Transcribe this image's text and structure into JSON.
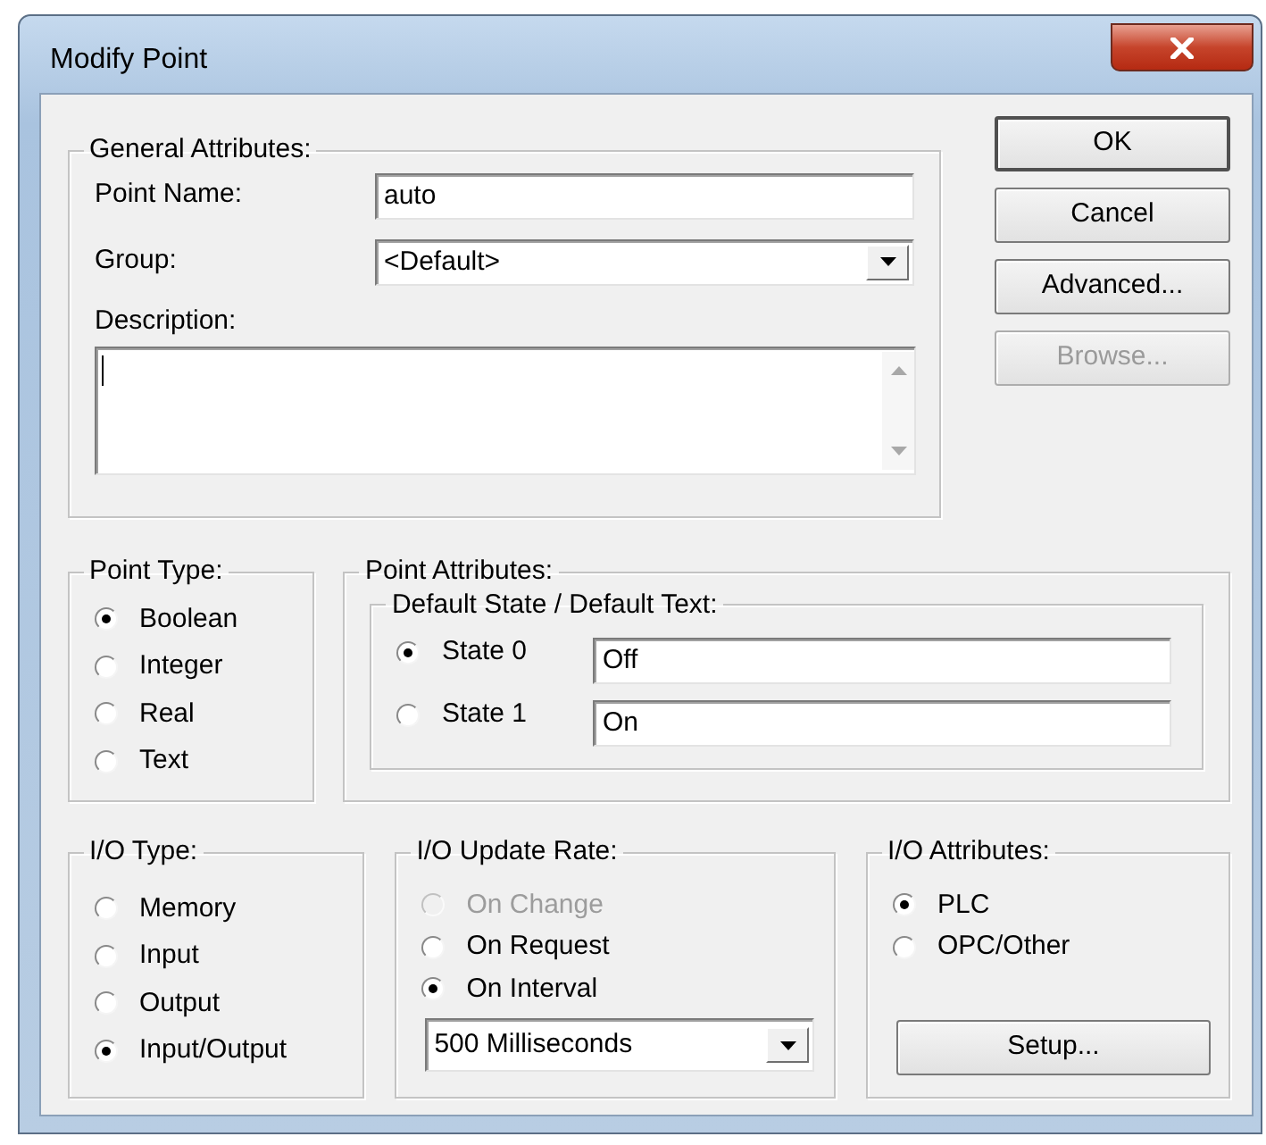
{
  "window": {
    "title": "Modify Point"
  },
  "general": {
    "title": "General Attributes:",
    "fields": [
      {
        "label": "Point Name:",
        "kind": "text",
        "value": "auto"
      },
      {
        "label": "Group:",
        "kind": "dropdown",
        "value": "<Default>"
      }
    ],
    "description": {
      "label": "Description:"
    }
  },
  "buttons": [
    {
      "label": "OK",
      "disabled": false
    },
    {
      "label": "Cancel",
      "disabled": false
    },
    {
      "label": "Advanced...",
      "disabled": false
    },
    {
      "label": "Browse...",
      "disabled": true
    }
  ],
  "point_type": {
    "title": "Point Type:",
    "options": [
      {
        "label": "Boolean",
        "selected": true
      },
      {
        "label": "Integer",
        "selected": false
      },
      {
        "label": "Real",
        "selected": false
      },
      {
        "label": "Text",
        "selected": false
      }
    ]
  },
  "point_attributes": {
    "title": "Point Attributes:",
    "subtitle": "Default State / Default Text:",
    "states": [
      {
        "label": "State 0",
        "selected": true,
        "value": "Off"
      },
      {
        "label": "State 1",
        "selected": false,
        "value": "On"
      }
    ]
  },
  "io_type": {
    "title": "I/O Type:",
    "options": [
      {
        "label": "Memory",
        "selected": false
      },
      {
        "label": "Input",
        "selected": false
      },
      {
        "label": "Output",
        "selected": false
      },
      {
        "label": "Input/Output",
        "selected": true
      }
    ]
  },
  "update_rate": {
    "title": "I/O Update Rate:",
    "options": [
      {
        "label": "On Change",
        "selected": false,
        "disabled": true
      },
      {
        "label": "On Request",
        "selected": false,
        "disabled": false
      },
      {
        "label": "On Interval",
        "selected": true,
        "disabled": false
      }
    ],
    "interval": "500 Milliseconds"
  },
  "io_attributes": {
    "title": "I/O Attributes:",
    "options": [
      {
        "label": "PLC",
        "selected": true
      },
      {
        "label": "OPC/Other",
        "selected": false
      }
    ],
    "button": "Setup..."
  }
}
